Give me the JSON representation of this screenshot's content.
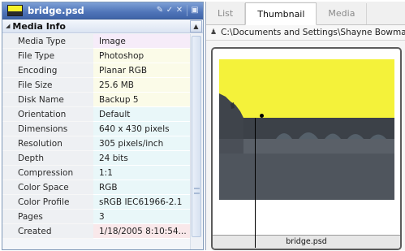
{
  "header": {
    "file_name": "bridge.psd",
    "tools": [
      "pencil-icon",
      "checkmark-icon",
      "reject-icon",
      "label-icon"
    ]
  },
  "section": {
    "title": "Media Info"
  },
  "rows": [
    {
      "label": "Media Type",
      "value": "Image",
      "bg": "#f6ecf9"
    },
    {
      "label": "File Type",
      "value": "Photoshop",
      "bg": "#fbfbe8"
    },
    {
      "label": "Encoding",
      "value": "Planar RGB",
      "bg": "#fbfbe8"
    },
    {
      "label": "File Size",
      "value": "25.6 MB",
      "bg": "#fbfbe8"
    },
    {
      "label": "Disk Name",
      "value": "Backup 5",
      "bg": "#fbfbe8"
    },
    {
      "label": "Orientation",
      "value": "Default",
      "bg": "#e9f7f9"
    },
    {
      "label": "Dimensions",
      "value": "640 x 430 pixels",
      "bg": "#e9f7f9"
    },
    {
      "label": "Resolution",
      "value": "305 pixels/inch",
      "bg": "#e9f7f9"
    },
    {
      "label": "Depth",
      "value": "24 bits",
      "bg": "#e9f7f9"
    },
    {
      "label": "Compression",
      "value": "1:1",
      "bg": "#e9f7f9"
    },
    {
      "label": "Color Space",
      "value": "RGB",
      "bg": "#e9f7f9"
    },
    {
      "label": "Color Profile",
      "value": "sRGB IEC61966-2.1",
      "bg": "#e9f7f9"
    },
    {
      "label": "Pages",
      "value": "3",
      "bg": "#e9f7f9"
    },
    {
      "label": "Created",
      "value": "1/18/2005 8:10:54...",
      "bg": "#f9e8ea"
    }
  ],
  "tabs": [
    {
      "label": "List",
      "active": false
    },
    {
      "label": "Thumbnail",
      "active": true
    },
    {
      "label": "Media",
      "active": false
    }
  ],
  "path": "C:\\Documents and Settings\\Shayne Bowman\\De",
  "thumbnail": {
    "caption": "bridge.psd"
  },
  "colors": {
    "title_bar": "#4f74b8",
    "sky": "#f4f23a",
    "water": "#4a4f57"
  }
}
